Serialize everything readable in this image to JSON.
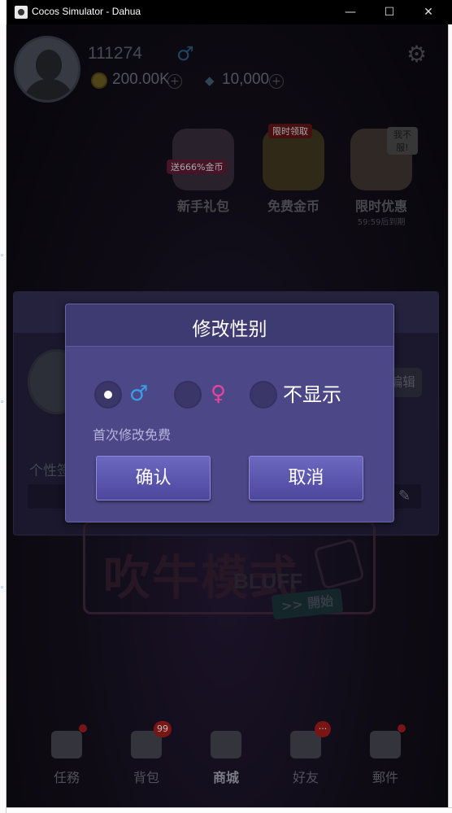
{
  "window": {
    "title": "Cocos Simulator - Dahua",
    "minimize": "—",
    "maximize": "☐",
    "close": "✕"
  },
  "profile": {
    "user_id": "111274",
    "gender_symbol": "♂",
    "coins": "200.00K",
    "gems": "10,000"
  },
  "promos": [
    {
      "badge": "送666%金币",
      "label": "新手礼包"
    },
    {
      "badge": "限时领取",
      "label": "免费金币"
    },
    {
      "badge": "我不服!",
      "label": "限时优惠",
      "sub": "59:59后到期"
    }
  ],
  "background_panel": {
    "edit_label": "编辑",
    "signature_label": "个性签"
  },
  "game_banner": {
    "title": "吹牛模式",
    "subtitle": "BLUFF",
    "start_label": ">> 開始"
  },
  "tabs": [
    {
      "label": "任務",
      "badge": ""
    },
    {
      "label": "背包",
      "badge": "99"
    },
    {
      "label": "商城",
      "badge": ""
    },
    {
      "label": "好友",
      "badge": "···"
    },
    {
      "label": "郵件",
      "badge": ""
    }
  ],
  "modal": {
    "title": "修改性别",
    "options": [
      {
        "symbol": "♂",
        "checked": true
      },
      {
        "symbol": "♀",
        "checked": false
      },
      {
        "label": "不显示",
        "checked": false
      }
    ],
    "hint": "首次修改免费",
    "confirm_label": "确认",
    "cancel_label": "取消"
  },
  "colors": {
    "modal_bg": "#4c4786",
    "button": "#5f5ab0",
    "male": "#3a9ee6",
    "female": "#e6459b"
  }
}
